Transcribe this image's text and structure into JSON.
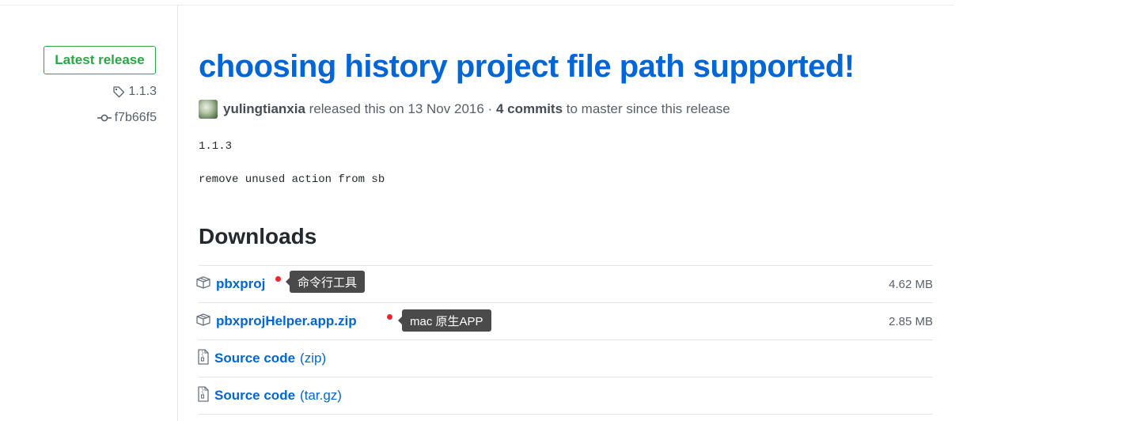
{
  "sidebar": {
    "latest_badge": "Latest release",
    "tag": "1.1.3",
    "commit": "f7b66f5"
  },
  "release": {
    "title": "choosing history project file path supported!",
    "author": "yulingtianxia",
    "released_text": "released this on 13 Nov 2016",
    "separator": "·",
    "commits": "4 commits",
    "since_text": "to master since this release",
    "notes": [
      "1.1.3",
      "remove unused action from sb"
    ]
  },
  "downloads": {
    "heading": "Downloads",
    "assets": [
      {
        "name": "pbxproj",
        "size": "4.62 MB",
        "icon": "package-icon",
        "annotation": "命令行工具"
      },
      {
        "name": "pbxprojHelper.app.zip",
        "size": "2.85 MB",
        "icon": "package-icon",
        "annotation": "mac 原生APP"
      },
      {
        "name": "Source code",
        "format": "(zip)",
        "icon": "file-zip-icon"
      },
      {
        "name": "Source code",
        "format": "(tar.gz)",
        "icon": "file-zip-icon"
      }
    ]
  },
  "colors": {
    "link": "#0366d6",
    "badge_green": "#28a745",
    "annotation_dot": "#f5222d",
    "tooltip_bg": "#4a4a4a"
  }
}
